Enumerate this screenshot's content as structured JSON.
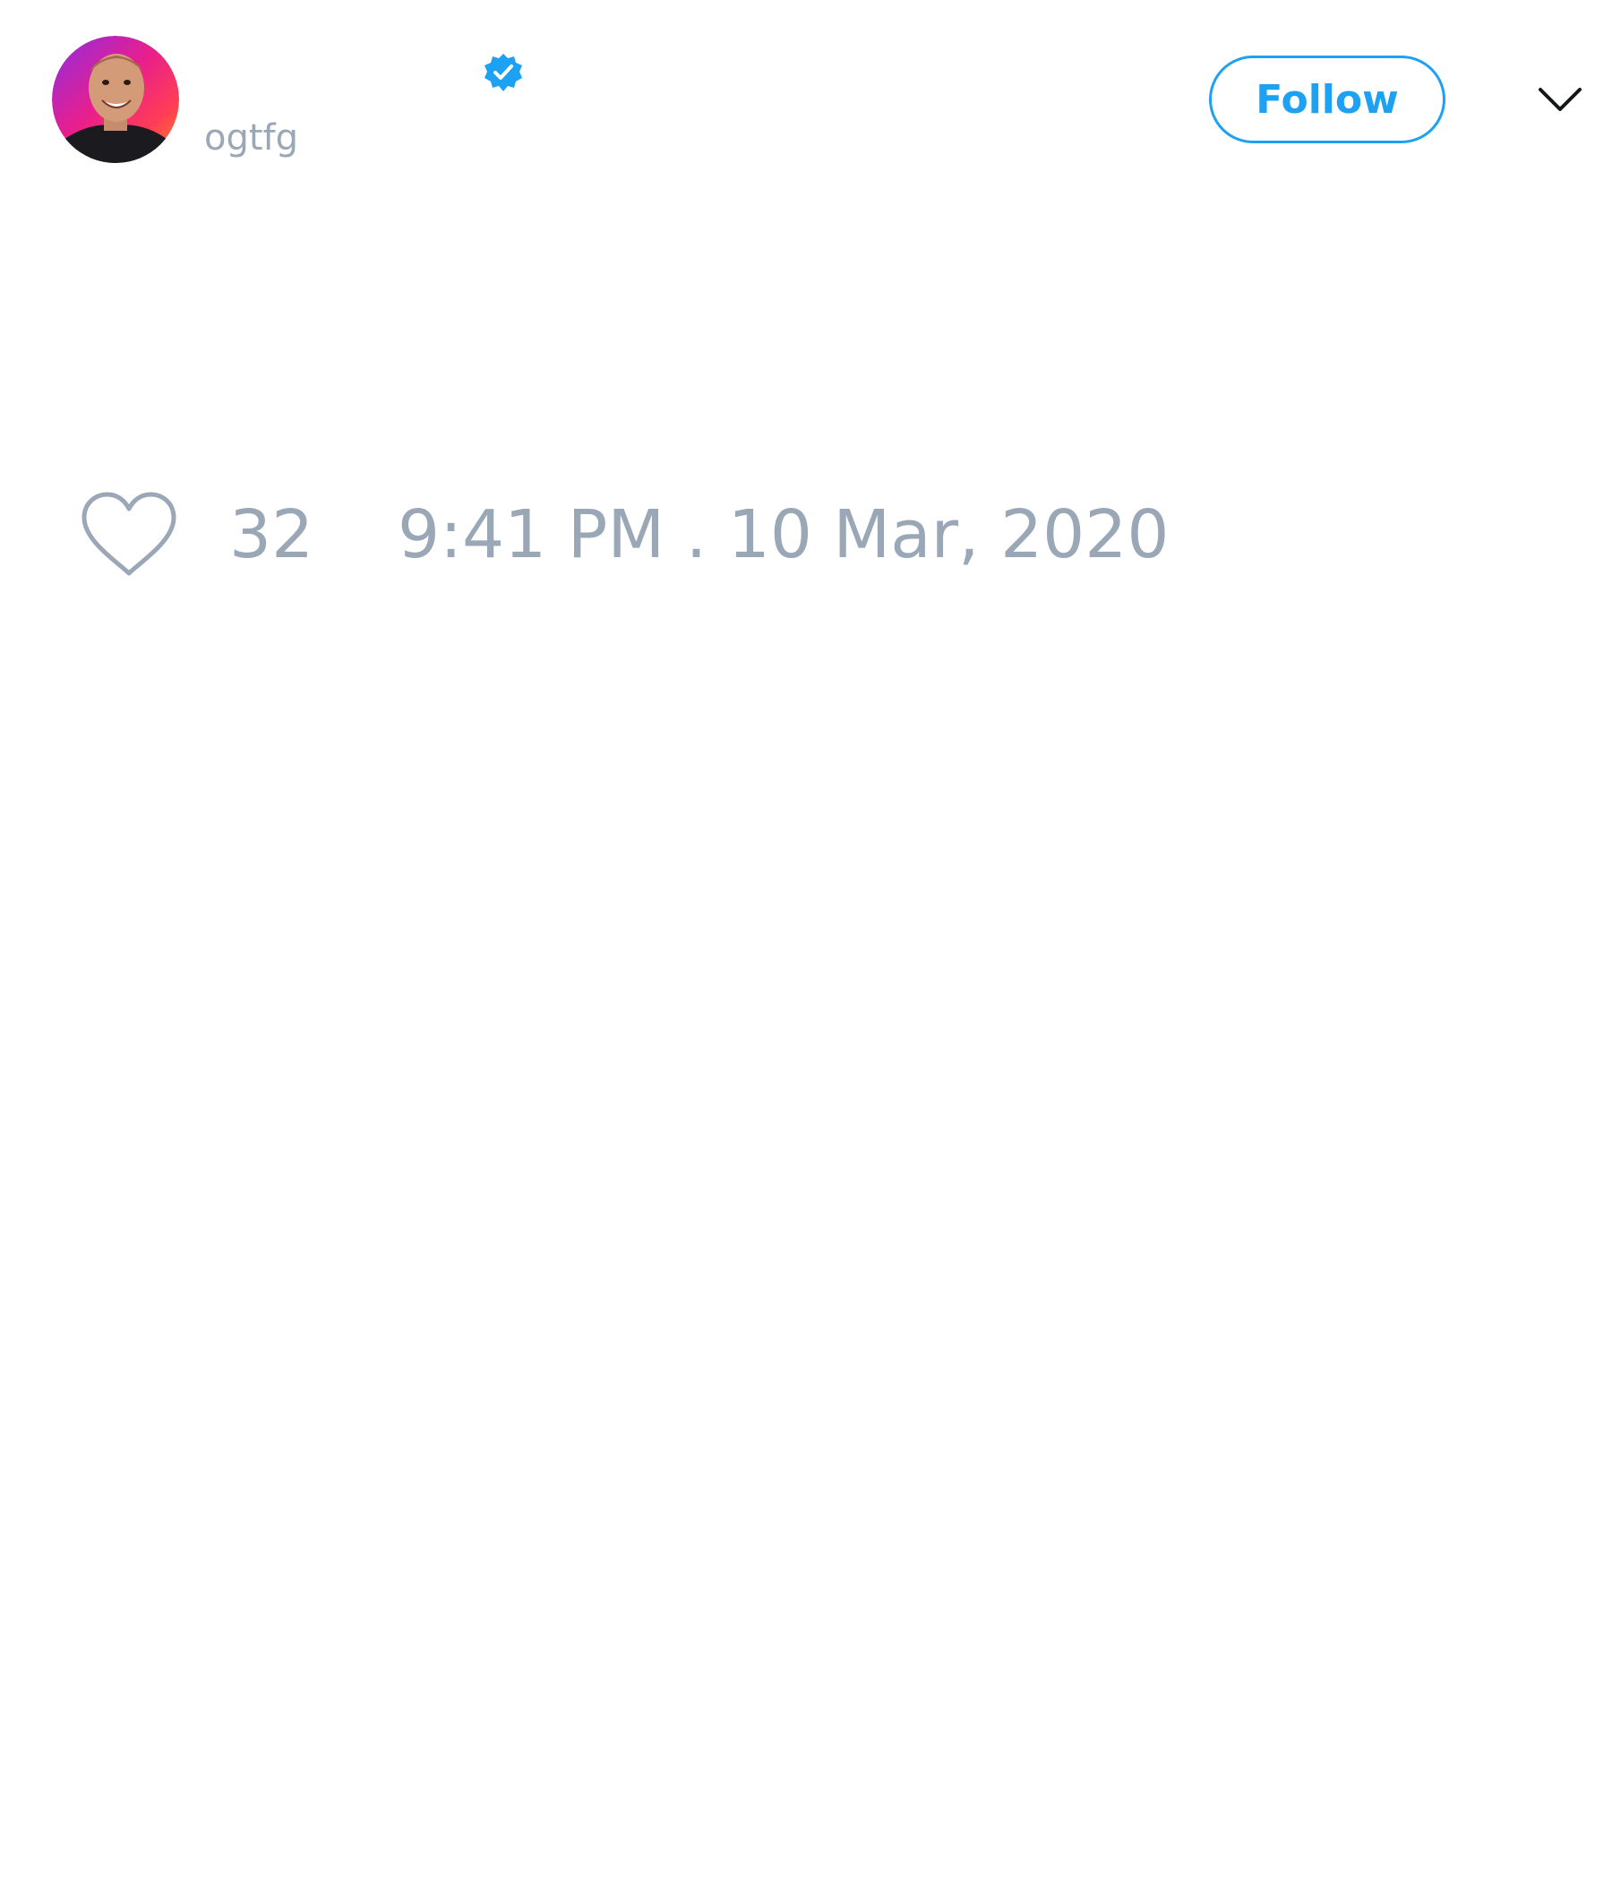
{
  "tweet": {
    "author": {
      "display_name": "",
      "handle": "ogtfg",
      "verified": true,
      "avatar_icon": "user-avatar-photo"
    },
    "follow_label": "Follow",
    "menu_icon": "chevron-down-icon",
    "like_icon": "heart-outline-icon",
    "like_count": "32",
    "timestamp": "9:41 PM . 10 Mar, 2020"
  },
  "colors": {
    "accent": "#1da1f2",
    "muted_text": "#9aa7b6",
    "background": "#ffffff"
  }
}
